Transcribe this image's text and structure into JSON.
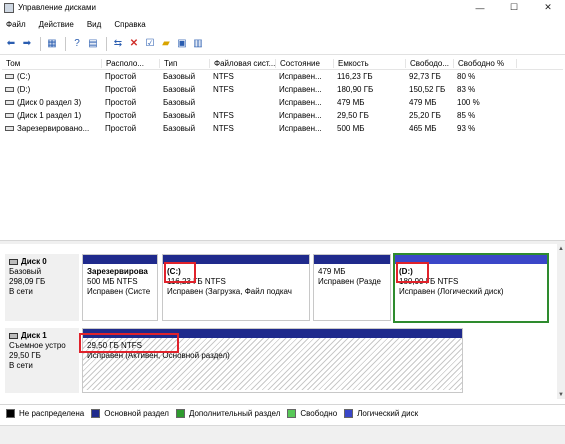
{
  "window": {
    "title": "Управление дисками",
    "min": "—",
    "max": "☐",
    "close": "✕"
  },
  "menu": [
    "Файл",
    "Действие",
    "Вид",
    "Справка"
  ],
  "table": {
    "headers": [
      "Том",
      "Располо...",
      "Тип",
      "Файловая сист...",
      "Состояние",
      "Емкость",
      "Свободо...",
      "Свободно %"
    ],
    "rows": [
      [
        "(C:)",
        "Простой",
        "Базовый",
        "NTFS",
        "Исправен...",
        "116,23 ГБ",
        "92,73 ГБ",
        "80 %"
      ],
      [
        "(D:)",
        "Простой",
        "Базовый",
        "NTFS",
        "Исправен...",
        "180,90 ГБ",
        "150,52 ГБ",
        "83 %"
      ],
      [
        "(Диск 0 раздел 3)",
        "Простой",
        "Базовый",
        "",
        "Исправен...",
        "479 МБ",
        "479 МБ",
        "100 %"
      ],
      [
        "(Диск 1 раздел 1)",
        "Простой",
        "Базовый",
        "NTFS",
        "Исправен...",
        "29,50 ГБ",
        "25,20 ГБ",
        "85 %"
      ],
      [
        "Зарезервировано...",
        "Простой",
        "Базовый",
        "NTFS",
        "Исправен...",
        "500 МБ",
        "465 МБ",
        "93 %"
      ]
    ]
  },
  "disks": [
    {
      "name": "Диск 0",
      "type": "Базовый",
      "size": "298,09 ГБ",
      "status": "В сети",
      "partitions": [
        {
          "title": "Зарезервирова",
          "size": "500 МБ NTFS",
          "status": "Исправен (Систе"
        },
        {
          "title": "(C:)",
          "size": "116,23 ГБ NTFS",
          "status": "Исправен (Загрузка, Файл подкач"
        },
        {
          "title": "",
          "size": "479 МБ",
          "status": "Исправен (Разде"
        },
        {
          "title": "(D:)",
          "size": "180,90 ГБ NTFS",
          "status": "Исправен (Логический диск)"
        }
      ]
    },
    {
      "name": "Диск 1",
      "type": "Съемное устро",
      "size": "29,50 ГБ",
      "status": "В сети",
      "partitions": [
        {
          "title": "",
          "size": "29,50 ГБ NTFS",
          "status": "Исправен (Активен, Основной раздел)"
        }
      ]
    }
  ],
  "legend": [
    {
      "label": "Не распределена",
      "color": "#000000"
    },
    {
      "label": "Основной раздел",
      "color": "#1f2a8c"
    },
    {
      "label": "Дополнительный раздел",
      "color": "#2e9b2e"
    },
    {
      "label": "Свободно",
      "color": "#58c858"
    },
    {
      "label": "Логический диск",
      "color": "#3a46c8"
    }
  ]
}
